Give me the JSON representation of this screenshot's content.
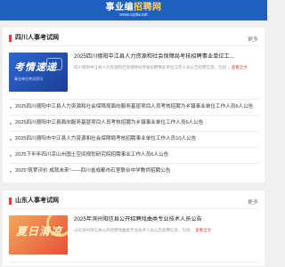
{
  "header": {
    "title_main": "事业编",
    "title_highlight": "招聘网",
    "subtitle": "www.sydw.net"
  },
  "sections": [
    {
      "title": "四川人事考试网",
      "more": "更多",
      "feature": {
        "thumb_big": "考情速递",
        "thumb_small": "事业单位考试资讯",
        "title": "2025四川德阳中江县人力资源和社会保障局考核招聘事业单位工…",
        "desc": "四川德阳中江县人力资源和社会保障局考核招聘事业单位工作人员公告招聘信息，包括…",
        "view": "查看全文"
      },
      "items": [
        "2025四川德阳中江县人力资源和社会保障局面向服务基层项目人员考核招聘为乡镇事业单位工作人员6人公告",
        "2025四川德阳中江县面向服务基层项目人员考核招聘为乡镇事业单位工作人员6人公告",
        "2025四川德阳市中江县人力资源和社会保障局考核招聘事业单位工作人员10人公告",
        "2025下半年四川凉山州国土空间规划研究院招聘事业工作人员6人公告",
        "2025“筑梦评价 成就未来”——四川省成都市石室联合中学教师招聘公告"
      ]
    },
    {
      "title": "山东人事考试网",
      "more": "更多",
      "feature": {
        "thumb_big": "夏日清凉",
        "thumb_small": "",
        "title": "2025年滨州阳信县公开招聘戏曲类专业技术人员公告",
        "desc": "山东滨州阳信县公开招聘戏曲类专业技术人员公告招聘信息，包括…",
        "view": "查看全文"
      }
    }
  ]
}
